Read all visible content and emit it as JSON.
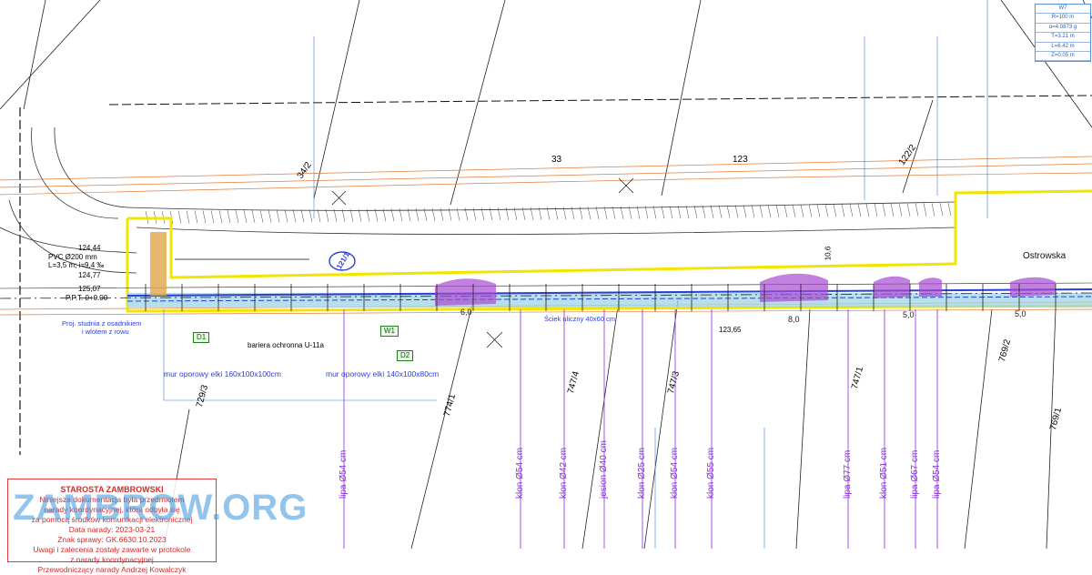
{
  "road": {
    "name": "Ostrowska",
    "code": "121/1"
  },
  "legend": {
    "title": "W7",
    "rows": [
      "R=100 m",
      "α=4.0873 g",
      "T=3.21 m",
      "L=6.42 m",
      "Z=0.05 m"
    ]
  },
  "parcels": [
    "34/2",
    "33",
    "123",
    "122/2",
    "729/3",
    "774/1",
    "747/4",
    "747/3",
    "747/1",
    "769/2",
    "769/1"
  ],
  "annotations": {
    "pvc1": "PVC Ø200 mm",
    "pvc2": "L=3,5 m; i=9,4 ‰",
    "ppt": "P.P.T. 0+0.00",
    "proj": "Proj. studnia z osadnikiem",
    "proj2": "i wlotem z rowu",
    "barrier": "bariera ochronna U-11a",
    "wall1": "mur oporowy elki 160x100x100cm",
    "wall2": "mur oporowy elki 140x100x80cm",
    "ciek": "Ściek uliczny 40x60 cm",
    "d1": "D1",
    "w1": "W1",
    "d2": "D2",
    "e1": "124,44",
    "e2": "124,77",
    "e3": "125,07",
    "e4": "123,65",
    "e5": "10,6"
  },
  "dimensions": [
    "6,0",
    "8,0",
    "5,0",
    "5,0"
  ],
  "trees": [
    "lipa Ø54 cm",
    "klon Ø54 cm",
    "klon Ø42 cm",
    "jesion Ø40 cm",
    "klon Ø25 cm",
    "klon Ø54 cm",
    "klon Ø55 cm",
    "lipa Ø77 cm",
    "klon Ø51 cm",
    "lipa Ø67 cm",
    "lipa Ø54 cm"
  ],
  "stamp": {
    "title": "STAROSTA ZAMBROWSKI",
    "lines": [
      "Niniejsza dokumentacja była przedmiotem",
      "narady koordynacyjnej, która odbyła się",
      "za pomocą środków komunikacji elektronicznej",
      "Data narady: 2023-03-21",
      "Znak sprawy: GK.6630.10.2023",
      "Uwagi i zalecenia zostały zawarte w protokole",
      "z narady koordynacyjnej",
      "Przewodniczący narady Andrzej Kowalczyk"
    ]
  },
  "watermark": "ZAMBROW.ORG",
  "colors": {
    "road_edge": "#f2e600",
    "utility": "#2a3fd6",
    "tree": "#8a2be2",
    "stamp": "#e23a3a",
    "terrain": "#e07a3a",
    "vegetation": "#2ea02e"
  }
}
